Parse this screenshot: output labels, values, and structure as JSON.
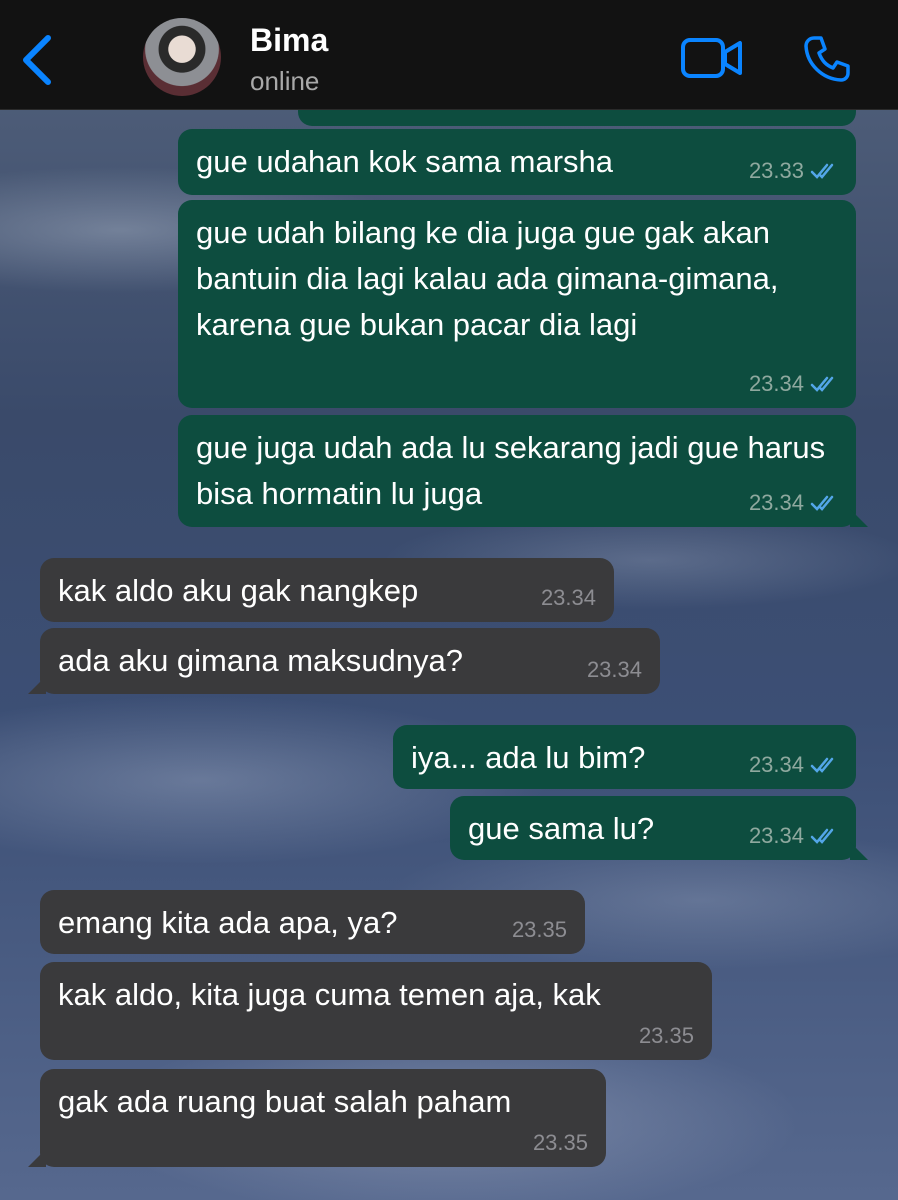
{
  "header": {
    "contact_name": "Bima",
    "status": "online"
  },
  "messages": [
    {
      "text": "gue udahan kok sama marsha",
      "time": "23.33",
      "direction": "outgoing",
      "read": true
    },
    {
      "text": "gue udah bilang ke dia juga gue gak akan bantuin dia lagi kalau ada gimana-gimana, karena gue bukan pacar dia lagi",
      "time": "23.34",
      "direction": "outgoing",
      "read": true
    },
    {
      "text": "gue juga udah ada lu sekarang jadi gue harus bisa hormatin lu juga",
      "time": "23.34",
      "direction": "outgoing",
      "read": true
    },
    {
      "text": "kak aldo aku gak nangkep",
      "time": "23.34",
      "direction": "incoming"
    },
    {
      "text": "ada aku gimana maksudnya?",
      "time": "23.34",
      "direction": "incoming"
    },
    {
      "text": "iya... ada lu bim?",
      "time": "23.34",
      "direction": "outgoing",
      "read": true
    },
    {
      "text": "gue sama lu?",
      "time": "23.34",
      "direction": "outgoing",
      "read": true
    },
    {
      "text": "emang kita ada apa, ya?",
      "time": "23.35",
      "direction": "incoming"
    },
    {
      "text": "kak aldo, kita juga cuma temen aja, kak",
      "time": "23.35",
      "direction": "incoming"
    },
    {
      "text": "gak ada ruang buat salah paham",
      "time": "23.35",
      "direction": "incoming"
    }
  ],
  "colors": {
    "outgoing_bubble": "#0d4d3f",
    "incoming_bubble": "#3a3a3c",
    "accent": "#0a84ff",
    "read_tick": "#53a6e8"
  },
  "icons": {
    "back": "chevron-left-icon",
    "video": "video-camera-icon",
    "call": "phone-icon",
    "read": "double-check-icon"
  }
}
